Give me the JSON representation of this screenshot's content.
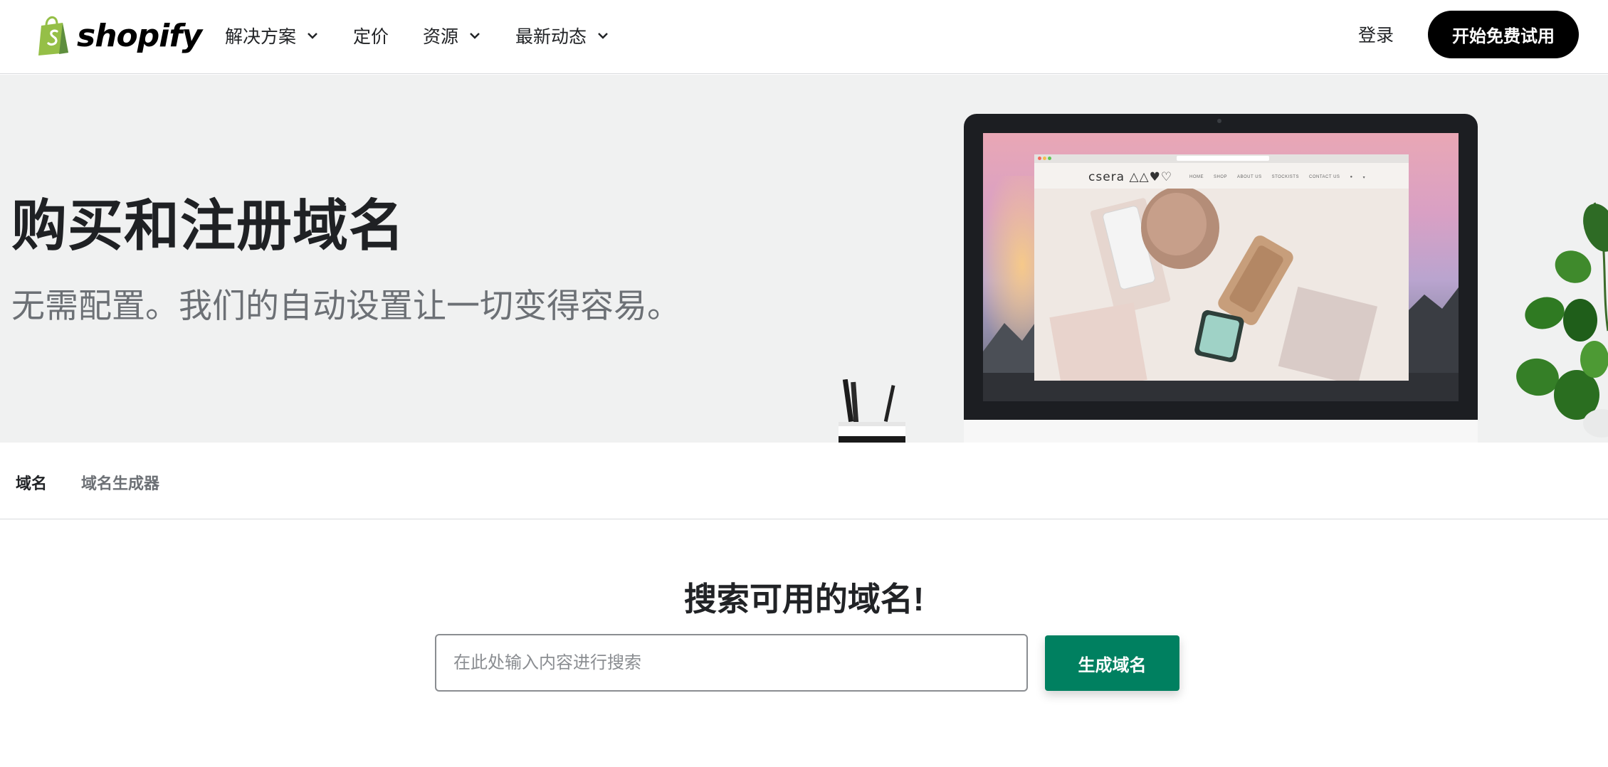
{
  "brand": {
    "name": "shopify",
    "color": "#95bf47"
  },
  "nav": {
    "items": [
      {
        "label": "解决方案",
        "has_dropdown": true
      },
      {
        "label": "定价",
        "has_dropdown": false
      },
      {
        "label": "资源",
        "has_dropdown": true
      },
      {
        "label": "最新动态",
        "has_dropdown": true
      }
    ],
    "login_label": "登录",
    "cta_label": "开始免费试用"
  },
  "hero": {
    "title": "购买和注册域名",
    "subtitle": "无需配置。我们的自动设置让一切变得容易。",
    "screen_site": {
      "logo": "csera △△♥♡",
      "links": [
        "HOME",
        "SHOP",
        "ABOUT US",
        "STOCKISTS",
        "CONTACT US"
      ]
    }
  },
  "tabs": [
    {
      "label": "域名",
      "active": true
    },
    {
      "label": "域名生成器",
      "active": false
    }
  ],
  "search": {
    "title": "搜索可用的域名!",
    "placeholder": "在此处输入内容进行搜索",
    "value": "",
    "button_label": "生成域名",
    "button_color": "#008060"
  }
}
